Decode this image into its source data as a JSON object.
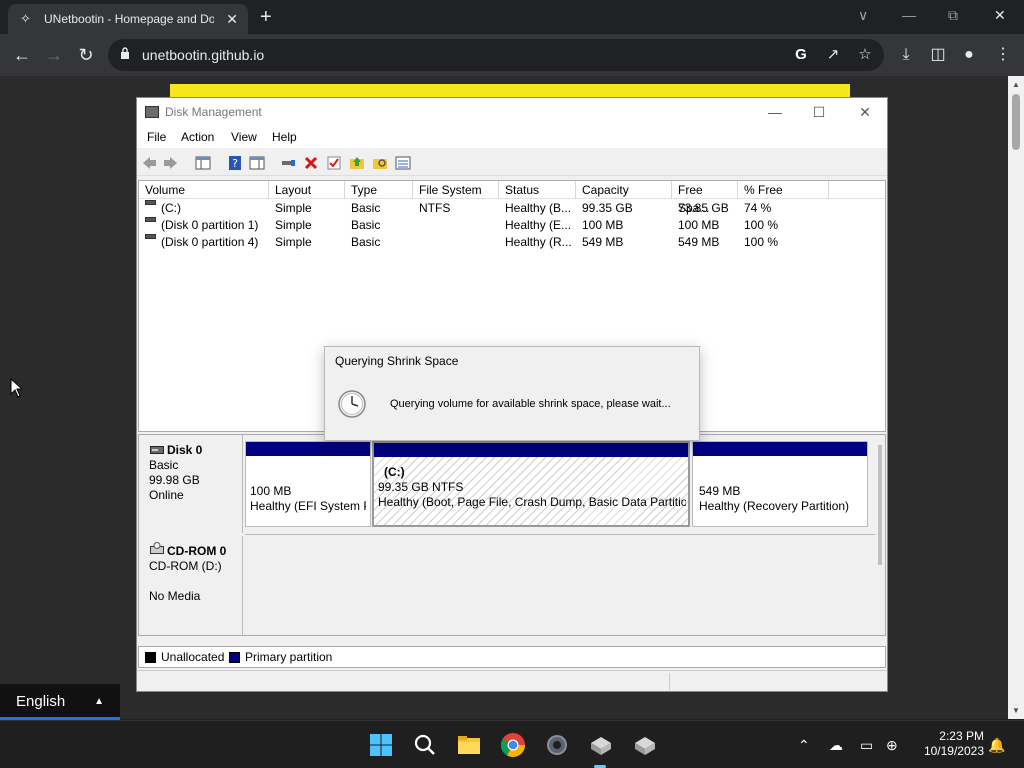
{
  "browser": {
    "tab_title": "UNetbootin - Homepage and Do",
    "tab_favicon": "unetbootin-favicon-icon",
    "url": "unetbootin.github.io",
    "window_controls": [
      "∨",
      "—",
      "⧉",
      "✕"
    ]
  },
  "page": {
    "banner_color": "#f5e71a",
    "language": "English"
  },
  "disk_management": {
    "title": "Disk Management",
    "menu": [
      "File",
      "Action",
      "View",
      "Help"
    ],
    "columns": [
      "Volume",
      "Layout",
      "Type",
      "File System",
      "Status",
      "Capacity",
      "Free Spa...",
      "% Free"
    ],
    "volumes": [
      [
        "(C:)",
        "Simple",
        "Basic",
        "NTFS",
        "Healthy (B...",
        "99.35 GB",
        "73.85 GB",
        "74 %"
      ],
      [
        "(Disk 0 partition 1)",
        "Simple",
        "Basic",
        "",
        "Healthy (E...",
        "100 MB",
        "100 MB",
        "100 %"
      ],
      [
        "(Disk 0 partition 4)",
        "Simple",
        "Basic",
        "",
        "Healthy (R...",
        "549 MB",
        "549 MB",
        "100 %"
      ]
    ],
    "disk0": {
      "name": "Disk 0",
      "type": "Basic",
      "size": "99.98 GB",
      "state": "Online",
      "partitions": [
        {
          "line1": "100 MB",
          "line2": "Healthy (EFI System P"
        },
        {
          "title": "(C:)",
          "line1": "99.35 GB NTFS",
          "line2": "Healthy (Boot, Page File, Crash Dump, Basic Data Partitior"
        },
        {
          "line1": "549 MB",
          "line2": "Healthy (Recovery Partition)"
        }
      ]
    },
    "cdrom": {
      "name": "CD-ROM 0",
      "type": "CD-ROM (D:)",
      "state": "No Media"
    },
    "legend": {
      "unallocated": "Unallocated",
      "primary": "Primary partition",
      "unallocated_color": "#000000",
      "primary_color": "#000080"
    }
  },
  "dialog": {
    "title": "Querying Shrink Space",
    "message": "Querying volume for available shrink space, please wait..."
  },
  "taskbar": {
    "time": "2:23 PM",
    "date": "10/19/2023",
    "pinned": [
      "windows-start-icon",
      "search-icon",
      "file-explorer-icon",
      "chrome-icon",
      "settings-icon",
      "disk-management-icon",
      "disk-management-icon"
    ]
  }
}
